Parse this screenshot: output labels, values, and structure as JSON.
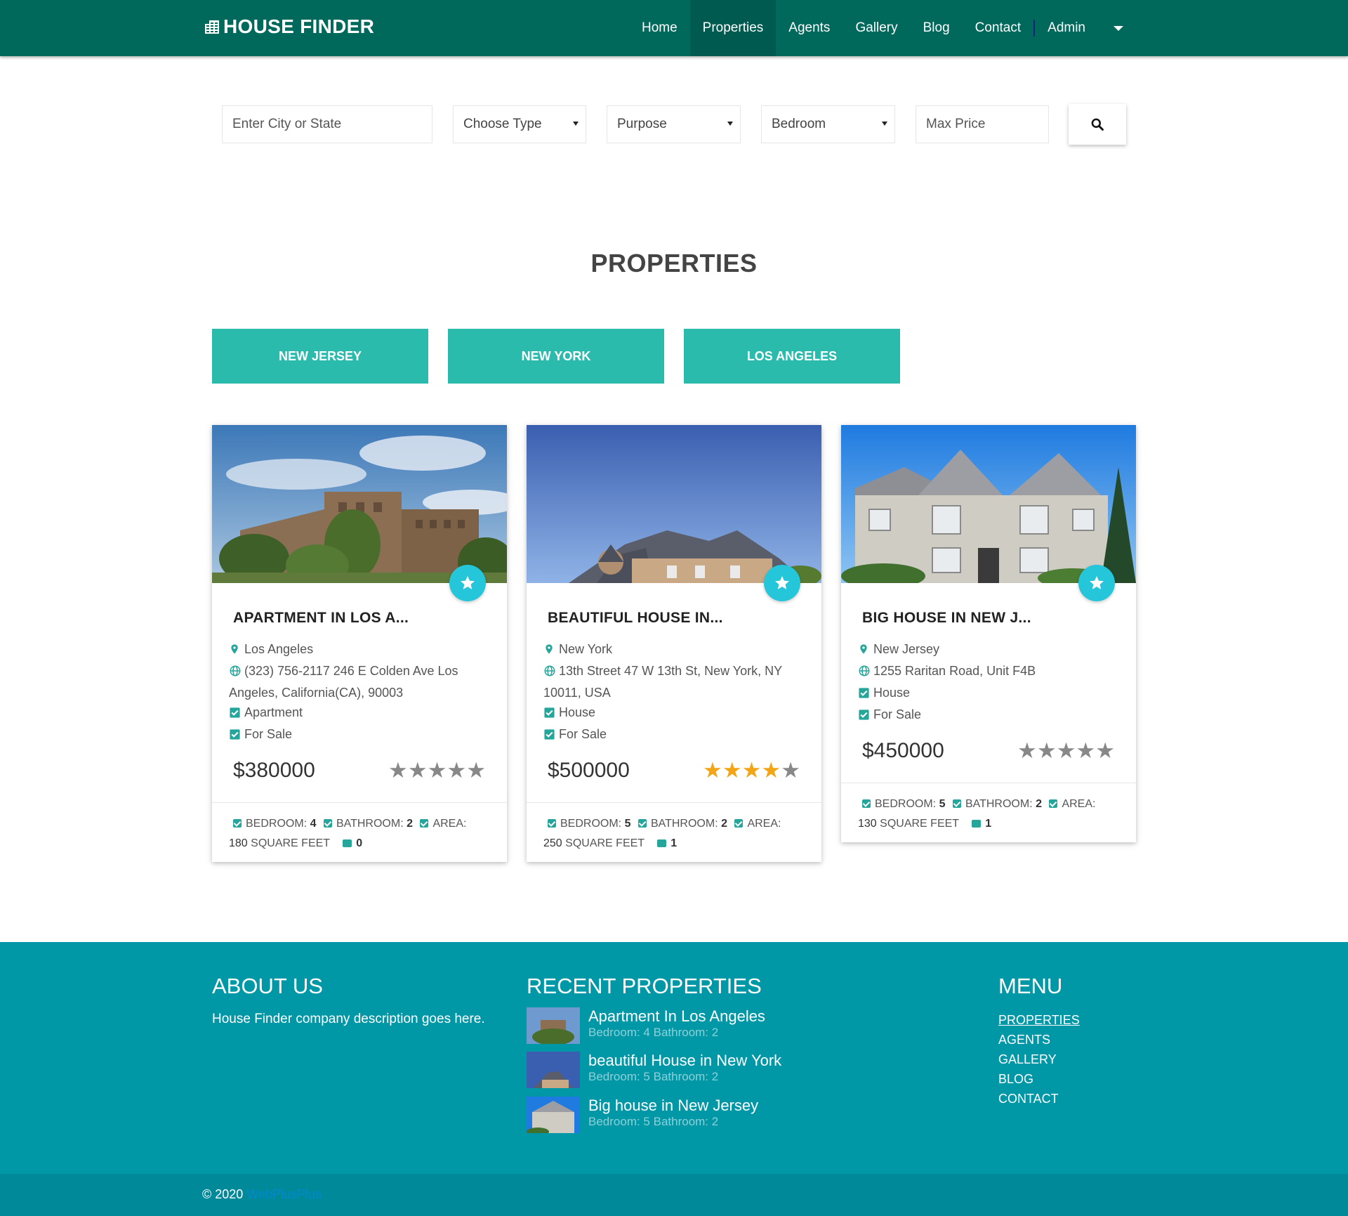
{
  "nav": {
    "brand": "HOUSE FINDER",
    "links": [
      "Home",
      "Properties",
      "Agents",
      "Gallery",
      "Blog",
      "Contact"
    ],
    "active": "Properties",
    "user": "Admin"
  },
  "search": {
    "city_placeholder": "Enter City or State",
    "type": "Choose Type",
    "purpose": "Purpose",
    "bedroom": "Bedroom",
    "price_placeholder": "Max Price"
  },
  "section_title": "PROPERTIES",
  "filters": [
    "NEW JERSEY",
    "NEW YORK",
    "LOS ANGELES"
  ],
  "cards": [
    {
      "title": "APARTMENT IN LOS A...",
      "city": "Los Angeles",
      "address": "(323) 756-2117 246 E Colden Ave Los Angeles, California(CA), 90003",
      "type": "Apartment",
      "purpose": "For Sale",
      "price": "$380000",
      "rating": 0,
      "bedroom_label": "BEDROOM:",
      "bedroom": "4",
      "bathroom_label": "BATHROOM:",
      "bathroom": "2",
      "area_label": "AREA:",
      "area": "180",
      "area_unit": "SQUARE FEET",
      "comments": "0"
    },
    {
      "title": "BEAUTIFUL HOUSE IN...",
      "city": "New York",
      "address": "13th Street 47 W 13th St, New York, NY 10011, USA",
      "type": "House",
      "purpose": "For Sale",
      "price": "$500000",
      "rating": 4,
      "bedroom_label": "BEDROOM:",
      "bedroom": "5",
      "bathroom_label": "BATHROOM:",
      "bathroom": "2",
      "area_label": "AREA:",
      "area": "250",
      "area_unit": "SQUARE FEET",
      "comments": "1"
    },
    {
      "title": "BIG HOUSE IN NEW J...",
      "city": "New Jersey",
      "address": "1255 Raritan Road, Unit F4B",
      "type": "House",
      "purpose": "For Sale",
      "price": "$450000",
      "rating": 0,
      "bedroom_label": "BEDROOM:",
      "bedroom": "5",
      "bathroom_label": "BATHROOM:",
      "bathroom": "2",
      "area_label": "AREA:",
      "area": "130",
      "area_unit": "SQUARE FEET",
      "comments": "1"
    }
  ],
  "footer": {
    "about_heading": "ABOUT US",
    "about_text": "House Finder company description goes here.",
    "recent_heading": "RECENT PROPERTIES",
    "recent": [
      {
        "title": "Apartment In Los Angeles",
        "sub": "Bedroom: 4 Bathroom: 2"
      },
      {
        "title": "beautiful House in New York",
        "sub": "Bedroom: 5 Bathroom: 2"
      },
      {
        "title": "Big house in New Jersey",
        "sub": "Bedroom: 5 Bathroom: 2"
      }
    ],
    "menu_heading": "MENU",
    "menu": [
      "PROPERTIES",
      "AGENTS",
      "GALLERY",
      "BLOG",
      "CONTACT"
    ],
    "copyright": "© 2020",
    "copyright_link": "WebPlusPlus"
  },
  "colors": {
    "navbar": "#00695c",
    "accent": "#2bbbad",
    "fav": "#26c6da",
    "star_on": "#f2a516",
    "star_off": "#888888",
    "footer": "#0097a7"
  }
}
